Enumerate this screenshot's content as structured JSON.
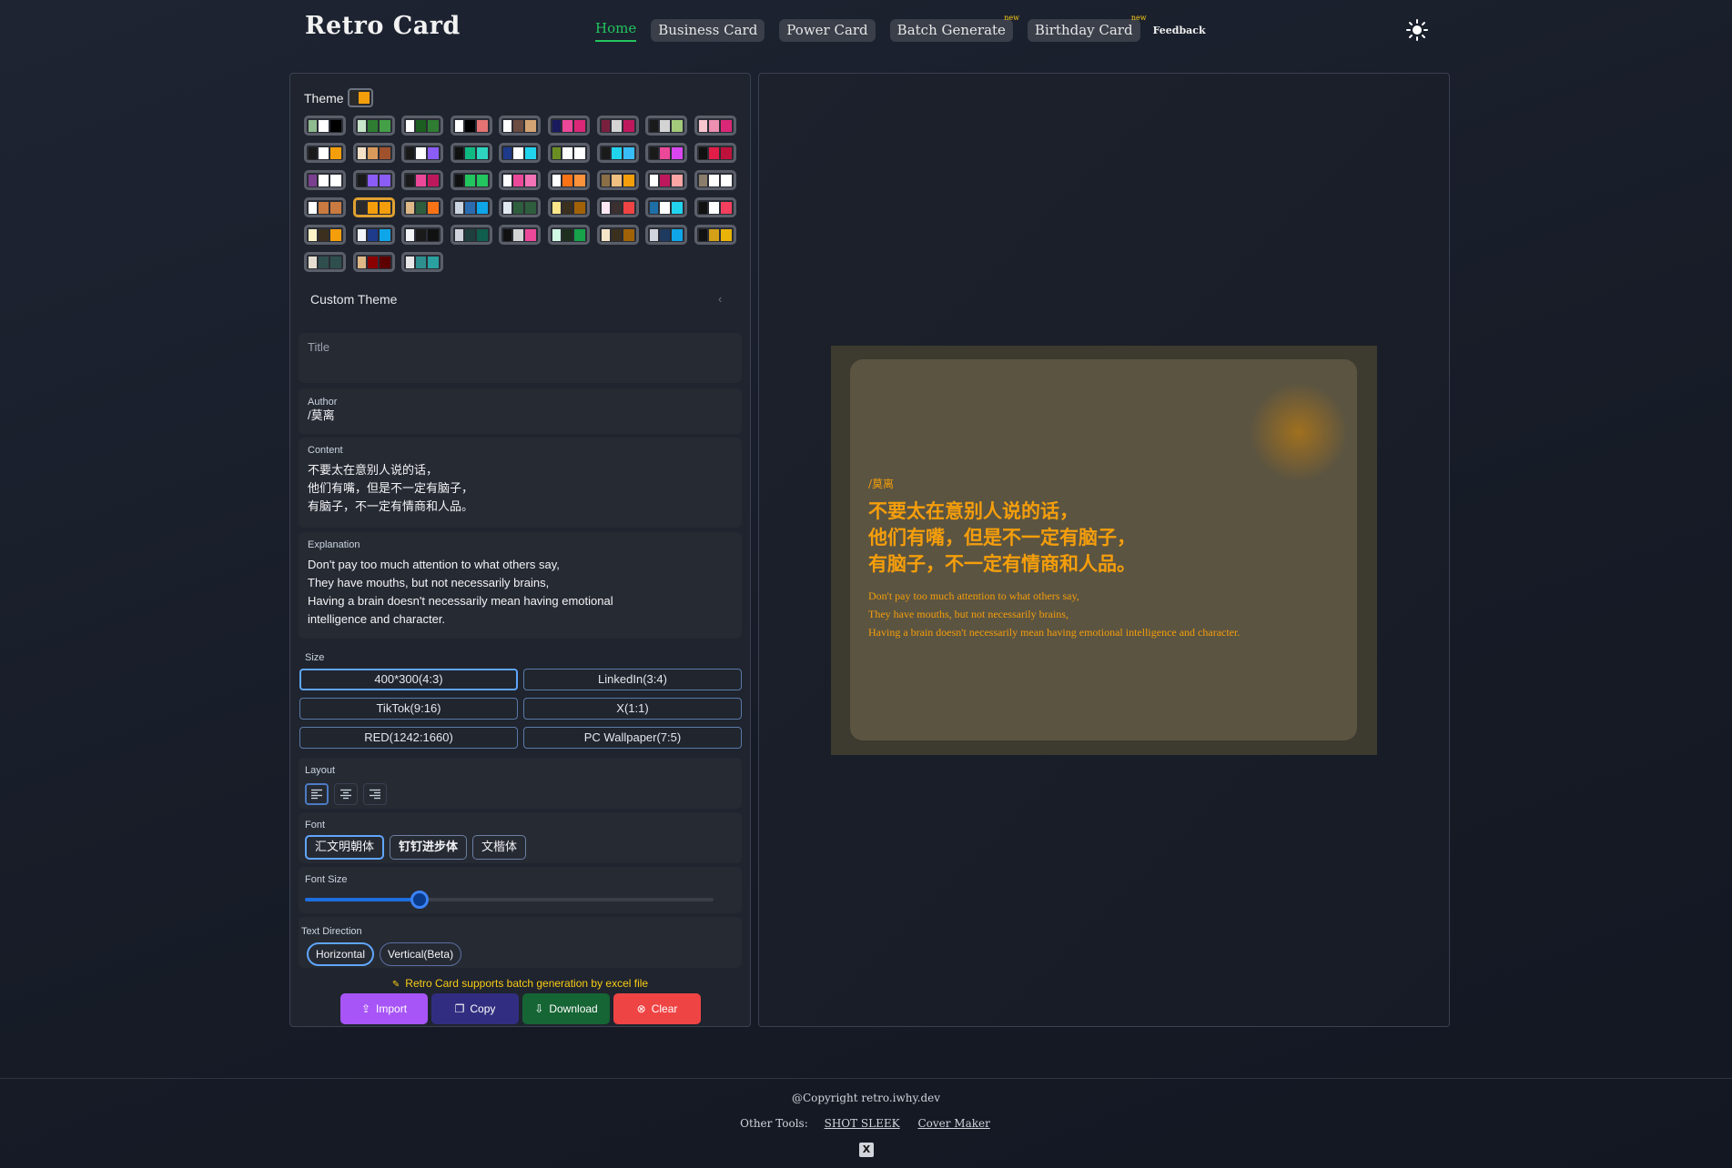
{
  "app": {
    "title": "Retro Card"
  },
  "nav": {
    "home": "Home",
    "business": "Business Card",
    "power": "Power Card",
    "batch": "Batch Generate",
    "birthday": "Birthday Card",
    "feedback": "Feedback",
    "new_badge": "new"
  },
  "theme": {
    "label": "Theme",
    "selected_index": 28,
    "swatches": [
      [
        "#8fbc8f",
        "#ffffff",
        "#000000"
      ],
      [
        "#c8e6c9",
        "#2e7d32",
        "#43a047"
      ],
      [
        "#ffffff",
        "#1b5e20",
        "#2e7d32"
      ],
      [
        "#ffffff",
        "#000000",
        "#e57373"
      ],
      [
        "#ffffff",
        "#6d4c41",
        "#d4a373"
      ],
      [
        "#1a1a5e",
        "#ec4899",
        "#db2777"
      ],
      [
        "#7b1f3f",
        "#d4d4d4",
        "#be185d"
      ],
      [
        "#1a1a1a",
        "#d4d4d4",
        "#a3c97a"
      ],
      [
        "#f9c6d0",
        "#ec8fb0",
        "#db2777"
      ],
      [
        "#1a1a1a",
        "#ffffff",
        "#f59e0b"
      ],
      [
        "#f5e1c8",
        "#d99a5b",
        "#a0522d"
      ],
      [
        "#1a1a1a",
        "#ffffff",
        "#8b5cf6"
      ],
      [
        "#111111",
        "#10b981",
        "#2dd4bf"
      ],
      [
        "#1e3a8a",
        "#ffffff",
        "#22d3ee"
      ],
      [
        "#6b8e23",
        "#ffffff",
        "#ffffff"
      ],
      [
        "#1a1a1a",
        "#22d3ee",
        "#38bdf8"
      ],
      [
        "#1a1a1a",
        "#ec4899",
        "#d946ef"
      ],
      [
        "#111111",
        "#e11d48",
        "#be123c"
      ],
      [
        "#7b3f8f",
        "#ffffff",
        "#ffffff"
      ],
      [
        "#1a1a1a",
        "#8b5cf6",
        "#8b5cf6"
      ],
      [
        "#1a1a1a",
        "#ec4899",
        "#be185d"
      ],
      [
        "#111111",
        "#22c55e",
        "#22c55e"
      ],
      [
        "#ffffff",
        "#ec4899",
        "#f472b6"
      ],
      [
        "#ffffff",
        "#f97316",
        "#fb923c"
      ],
      [
        "#8b6f47",
        "#f0c080",
        "#f59e0b"
      ],
      [
        "#ffffff",
        "#be185d",
        "#fca5a5"
      ],
      [
        "#8b7d6b",
        "#ffffff",
        "#ffffff"
      ],
      [
        "#ffffff",
        "#c97a40",
        "#c97a40"
      ],
      [
        "#2a2a2a",
        "#f59e0b",
        "#f59e0b"
      ],
      [
        "#deb887",
        "#2e5e3e",
        "#f97316"
      ],
      [
        "#cbd5e1",
        "#2b6cb0",
        "#0ea5e9"
      ],
      [
        "#e2e8f0",
        "#2f5e3e",
        "#2f5e3e"
      ],
      [
        "#fde68a",
        "#3b2f1e",
        "#a16207"
      ],
      [
        "#fce7f3",
        "#3b2f2f",
        "#ef4444"
      ],
      [
        "#1e6fa8",
        "#ffffff",
        "#22d3ee"
      ],
      [
        "#111111",
        "#ffffff",
        "#f43f5e"
      ],
      [
        "#fef3c7",
        "#3b2f1e",
        "#f59e0b"
      ],
      [
        "#f1f5f9",
        "#1e3a8a",
        "#0ea5e9"
      ],
      [
        "#f3f4f6",
        "#1a1a1a",
        "#111111"
      ],
      [
        "#d1d5db",
        "#1f3f3f",
        "#0f5e4e"
      ],
      [
        "#111111",
        "#d4d4d4",
        "#ec4899"
      ],
      [
        "#d1fae5",
        "#1f2f1f",
        "#16a34a"
      ],
      [
        "#f5e6c8",
        "#3b2f1e",
        "#a16207"
      ],
      [
        "#d1d5db",
        "#1f3a5f",
        "#0ea5e9"
      ],
      [
        "#111111",
        "#d4a017",
        "#eab308"
      ],
      [
        "#e5ded0",
        "#2f4f4f",
        "#2f4f4f"
      ],
      [
        "#deb887",
        "#8b0000",
        "#5c0000"
      ],
      [
        "#e8e8e8",
        "#2f8f8f",
        "#2aa0a0"
      ]
    ],
    "current_theme_accent": "#f59e0b"
  },
  "custom_theme": {
    "label": "Custom Theme",
    "chevron": "‹"
  },
  "fields": {
    "title_label": "Title",
    "author_label": "Author",
    "author_value": "/莫离",
    "content_label": "Content",
    "content_value": "不要太在意别人说的话，\n他们有嘴，但是不一定有脑子，\n有脑子，不一定有情商和人品。",
    "explanation_label": "Explanation",
    "explanation_value": "Don't pay too much attention to what others say,\nThey have mouths, but not necessarily brains,\nHaving a brain doesn't necessarily mean having emotional\nintelligence and character."
  },
  "size": {
    "label": "Size",
    "options": [
      "400*300(4:3)",
      "LinkedIn(3:4)",
      "TikTok(9:16)",
      "X(1:1)",
      "RED(1242:1660)",
      "PC Wallpaper(7:5)"
    ],
    "selected": "400*300(4:3)"
  },
  "layout": {
    "label": "Layout",
    "options": [
      "align-left-icon",
      "align-center-icon",
      "align-right-icon"
    ],
    "selected": "align-left"
  },
  "font": {
    "label": "Font",
    "options": [
      "汇文明朝体",
      "钉钉进步体",
      "文楷体"
    ],
    "selected": "汇文明朝体"
  },
  "font_size": {
    "label": "Font Size",
    "value_fraction": 0.28
  },
  "text_direction": {
    "label": "Text Direction",
    "options": [
      "Horizontal",
      "Vertical(Beta)"
    ],
    "selected": "Horizontal"
  },
  "notice": "Retro Card supports batch generation by excel file",
  "actions": {
    "import": "Import",
    "copy": "Copy",
    "download": "Download",
    "clear": "Clear"
  },
  "card": {
    "author": "/莫离",
    "content": "不要太在意别人说的话，\n他们有嘴，但是不一定有脑子，\n有脑子，不一定有情商和人品。",
    "explanation": "Don't pay too much attention to what others say,\nThey have mouths, but not necessarily brains,\nHaving a brain doesn't necessarily mean having emotional intelligence and character.",
    "text_color": "#f59e0b",
    "bg_outer": "#3d3a2f",
    "bg_inner": "#5b5441"
  },
  "footer": {
    "copyright": "@Copyright retro.iwhy.dev",
    "other_tools": "Other Tools:",
    "tool1": "SHOT SLEEK",
    "tool2": "Cover Maker",
    "x_icon": "x-logo-icon"
  }
}
